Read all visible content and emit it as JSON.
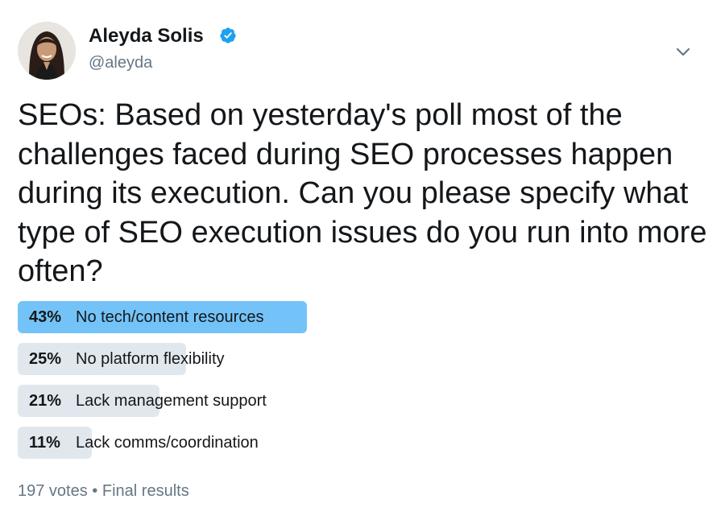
{
  "author": {
    "name": "Aleyda Solis",
    "handle": "@aleyda",
    "verified_icon": "verified-badge-icon",
    "avatar_icon": "profile-photo"
  },
  "menu": {
    "icon": "chevron-down-icon"
  },
  "tweet": {
    "text": "SEOs: Based on yesterday's poll most of the challenges faced during SEO processes happen during its execution. Can you please specify what type of SEO execution issues do you run into more often?"
  },
  "poll": {
    "options": [
      {
        "percent": "43%",
        "value": 43,
        "label": "No tech/content resources",
        "leader": true
      },
      {
        "percent": "25%",
        "value": 25,
        "label": "No platform flexibility",
        "leader": false
      },
      {
        "percent": "21%",
        "value": 21,
        "label": "Lack management support",
        "leader": false
      },
      {
        "percent": "11%",
        "value": 11,
        "label": "Lack comms/coordination",
        "leader": false
      }
    ],
    "votes": "197 votes",
    "separator": "•",
    "status": "Final results"
  },
  "colors": {
    "leader_bar": "#74c3f8",
    "other_bar": "#e1e8ed",
    "verified": "#1da1f2",
    "muted_text": "#657786"
  }
}
